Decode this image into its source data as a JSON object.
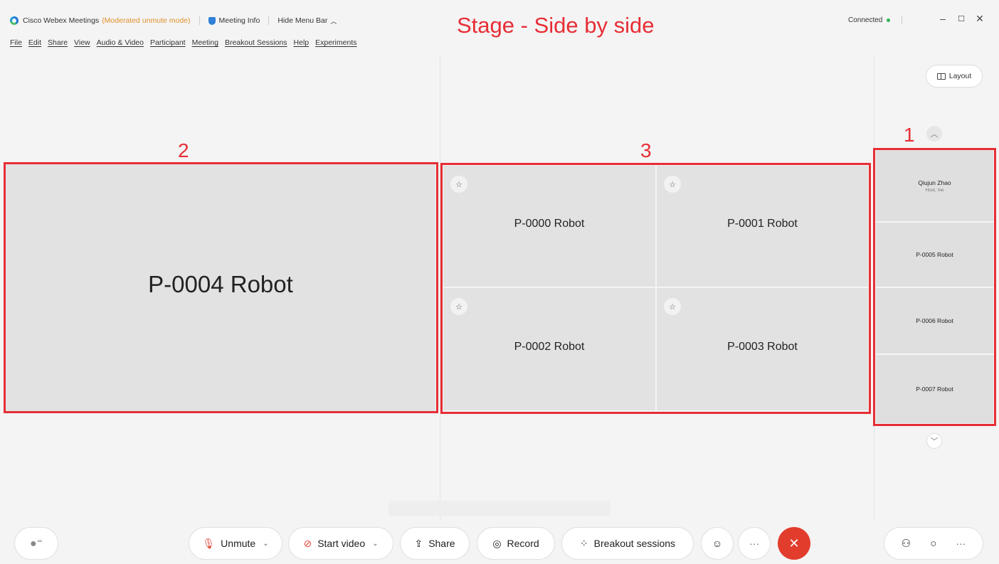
{
  "titlebar": {
    "app_name": "Cisco Webex Meetings",
    "mode": "(Moderated unmute mode)",
    "meeting_info": "Meeting Info",
    "hide_menu_bar": "Hide Menu Bar",
    "connection_status": "Connected"
  },
  "window_controls": {
    "minimize": "–",
    "maximize": "☐",
    "close": "✕"
  },
  "annotation": {
    "stage_title": "Stage - Side by side",
    "label_1": "1",
    "label_2": "2",
    "label_3": "3"
  },
  "menu": {
    "items": [
      "File",
      "Edit",
      "Share",
      "View",
      "Audio & Video",
      "Participant",
      "Meeting",
      "Breakout Sessions",
      "Help",
      "Experiments"
    ]
  },
  "layout_button": {
    "label": "Layout"
  },
  "stage": {
    "main_tile": "P-0004 Robot",
    "grid_tiles": [
      "P-0000 Robot",
      "P-0001 Robot",
      "P-0002 Robot",
      "P-0003 Robot"
    ]
  },
  "filmstrip": {
    "tiles": [
      {
        "name": "Qiujun Zhao",
        "role": "Host, me"
      },
      {
        "name": "P-0005 Robot"
      },
      {
        "name": "P-0006 Robot"
      },
      {
        "name": "P-0007 Robot"
      }
    ]
  },
  "controls": {
    "unmute": "Unmute",
    "start_video": "Start video",
    "share": "Share",
    "record": "Record",
    "breakout_sessions": "Breakout sessions",
    "more": "···",
    "end": "✕"
  },
  "right_panel_buttons": {
    "more": "···"
  },
  "colors": {
    "annotation_red": "#e62e36",
    "end_red": "#e23c2c",
    "connected_green": "#2db553",
    "mode_orange": "#e0912b"
  }
}
